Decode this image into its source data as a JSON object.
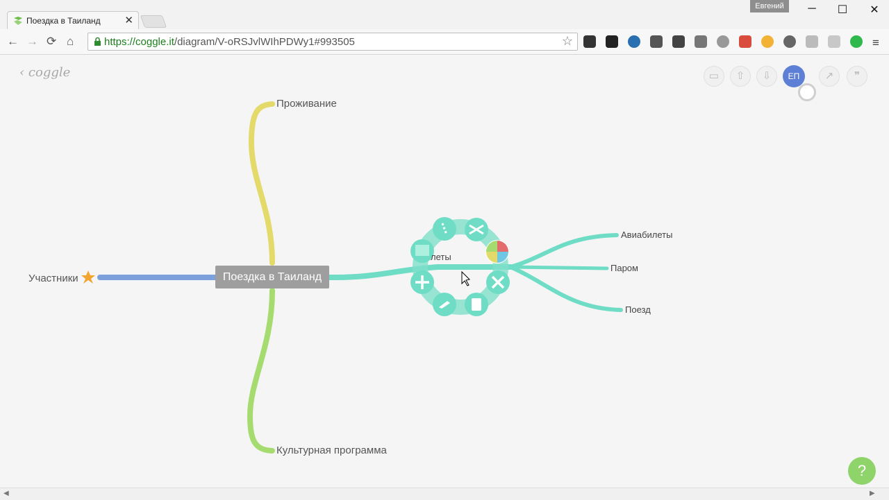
{
  "browser": {
    "tab_title": "Поездка в Таиланд",
    "tab_close": "✕",
    "user": "Евгений",
    "url_green": "https://coggle.it",
    "url_rest": "/diagram/V-oRSJvlWIhPDWy1#993505",
    "nav": {
      "back": "←",
      "forward": "→",
      "reload": "⟳",
      "home": "⌂",
      "star": "☆",
      "menu": "≡"
    },
    "window": {
      "minimize": "─",
      "maximize": "☐",
      "close": "✕"
    }
  },
  "app": {
    "logo": "‹ coggle",
    "toolbar": {
      "present": "▭",
      "upload": "⇧",
      "download": "⇩",
      "avatar": "ЕП",
      "history": "↗",
      "quote": "❞"
    },
    "help": "?"
  },
  "mindmap": {
    "center": "Поездка в Таиланд",
    "branches": {
      "top": "Проживание",
      "bottom": "Культурная программа",
      "left": "Участники",
      "right_partial": "леты"
    },
    "sub_branches": [
      "Авиабилеты",
      "Паром",
      "Поезд"
    ]
  },
  "colors": {
    "yellow": "#e3da6a",
    "green": "#a6dc6f",
    "blue": "#7ca0dc",
    "teal": "#6fdcc5",
    "help": "#8fd46a"
  },
  "icons": [
    "favicon-icon",
    "lock-icon",
    "star-icon",
    "star-badge-icon",
    "plus-icon",
    "close-icon",
    "scissors-icon",
    "color-wheel-icon",
    "quote-icon",
    "link-icon",
    "image-icon",
    "note-icon"
  ]
}
